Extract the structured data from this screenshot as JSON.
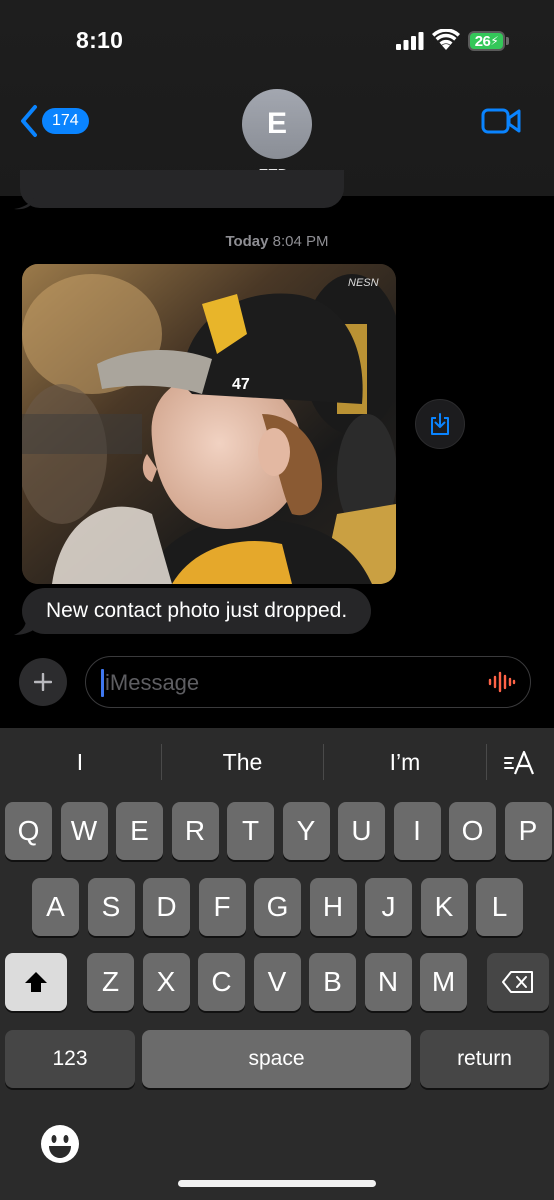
{
  "status": {
    "time": "8:10",
    "battery": "26"
  },
  "header": {
    "back_count": "174",
    "avatar_initial": "E",
    "contact_name": "ETD",
    "contact_chevron": "›"
  },
  "conversation": {
    "timestamp_day": "Today",
    "timestamp_time": "8:04 PM",
    "photo_watermark": "NESN",
    "cap_logo": "47",
    "message": "New contact photo just dropped."
  },
  "input": {
    "placeholder": "iMessage"
  },
  "keyboard": {
    "suggestions": [
      "I",
      "The",
      "I’m"
    ],
    "rows": [
      [
        "Q",
        "W",
        "E",
        "R",
        "T",
        "Y",
        "U",
        "I",
        "O",
        "P"
      ],
      [
        "A",
        "S",
        "D",
        "F",
        "G",
        "H",
        "J",
        "K",
        "L"
      ],
      [
        "Z",
        "X",
        "C",
        "V",
        "B",
        "N",
        "M"
      ]
    ],
    "numbers_label": "123",
    "space_label": "space",
    "return_label": "return"
  },
  "colors": {
    "accent": "#0a84ff",
    "battery": "#34c759",
    "bubble": "#262628",
    "dictation": "#ff6347"
  },
  "icons": [
    "signal-icon",
    "wifi-icon",
    "battery-icon",
    "back-chevron-icon",
    "video-camera-icon",
    "save-download-icon",
    "plus-icon",
    "dictation-waveform-icon",
    "text-format-icon",
    "shift-icon",
    "delete-icon",
    "emoji-icon"
  ]
}
